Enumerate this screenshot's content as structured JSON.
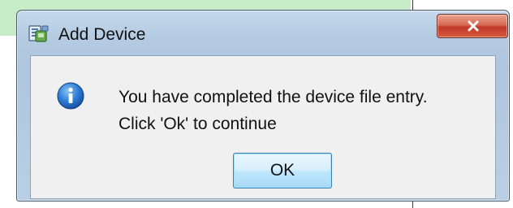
{
  "dialog": {
    "title": "Add Device",
    "title_icon": "device-app-icon",
    "close_label": "X",
    "message_icon": "info-icon",
    "message_line1": "You have completed the device file entry.",
    "message_line2": "Click 'Ok' to continue",
    "ok_label": "OK"
  },
  "colors": {
    "backdrop_green": "#c8ecc8",
    "close_button_red": "#c2382a",
    "info_icon_blue": "#1f64c8",
    "ok_button_blue": "#bee6fd"
  }
}
